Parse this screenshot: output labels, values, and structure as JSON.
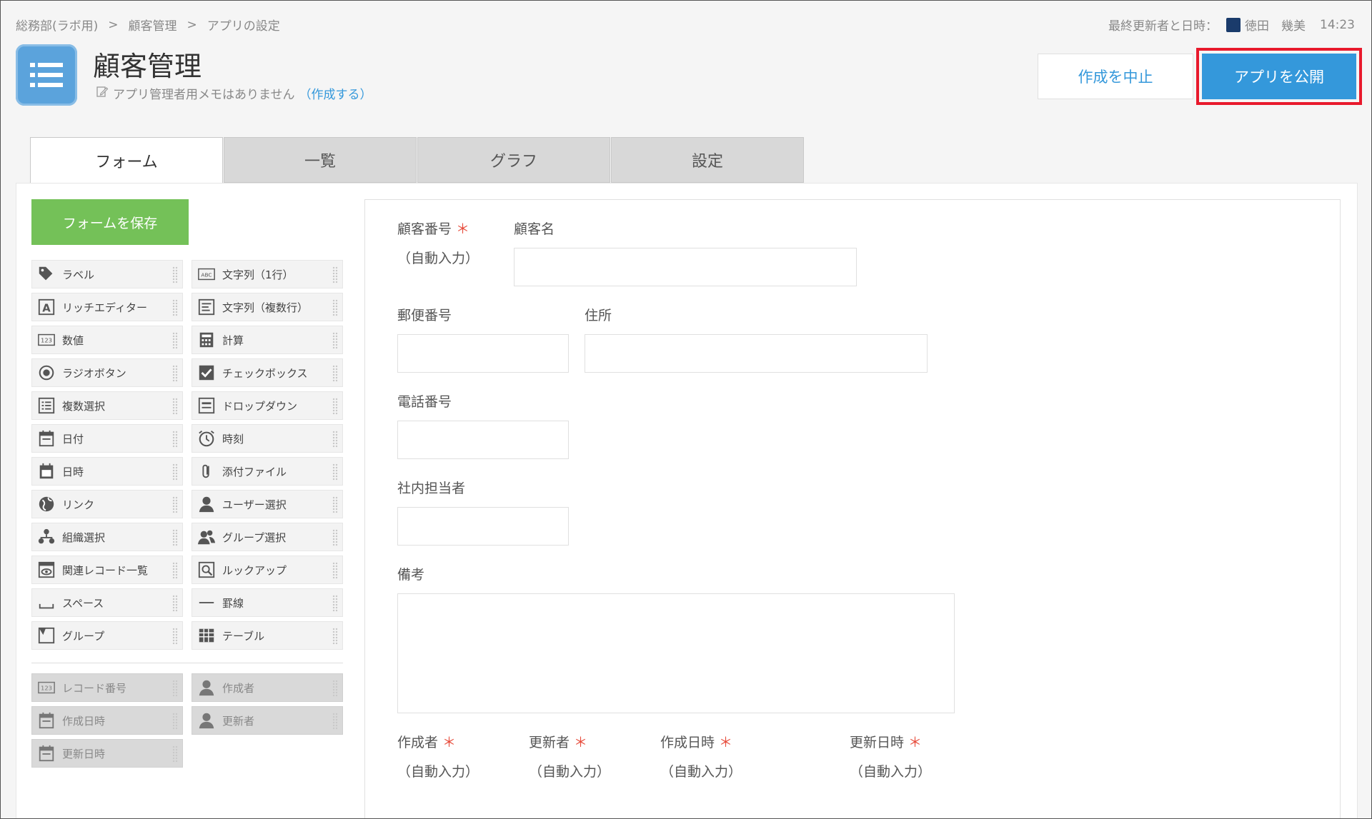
{
  "breadcrumb": [
    "総務部(ラボ用)",
    "顧客管理",
    "アプリの設定"
  ],
  "breadcrumb_sep": ">",
  "meta": {
    "label": "最終更新者と日時：",
    "user": "徳田　幾美",
    "time": "14:23"
  },
  "app": {
    "title": "顧客管理",
    "memo_text": "アプリ管理者用メモはありません",
    "memo_link": "（作成する）"
  },
  "actions": {
    "cancel": "作成を中止",
    "publish": "アプリを公開"
  },
  "tabs": [
    "フォーム",
    "一覧",
    "グラフ",
    "設定"
  ],
  "save_form": "フォームを保存",
  "palette": [
    {
      "label": "ラベル",
      "icon": "tag-icon"
    },
    {
      "label": "文字列（1行）",
      "icon": "abc-icon"
    },
    {
      "label": "リッチエディター",
      "icon": "rich-text-icon"
    },
    {
      "label": "文字列（複数行）",
      "icon": "multiline-icon"
    },
    {
      "label": "数値",
      "icon": "number-icon"
    },
    {
      "label": "計算",
      "icon": "calculator-icon"
    },
    {
      "label": "ラジオボタン",
      "icon": "radio-icon"
    },
    {
      "label": "チェックボックス",
      "icon": "checkbox-icon"
    },
    {
      "label": "複数選択",
      "icon": "multi-select-icon"
    },
    {
      "label": "ドロップダウン",
      "icon": "dropdown-icon"
    },
    {
      "label": "日付",
      "icon": "calendar-icon"
    },
    {
      "label": "時刻",
      "icon": "clock-icon"
    },
    {
      "label": "日時",
      "icon": "datetime-icon"
    },
    {
      "label": "添付ファイル",
      "icon": "paperclip-icon"
    },
    {
      "label": "リンク",
      "icon": "globe-icon"
    },
    {
      "label": "ユーザー選択",
      "icon": "user-icon"
    },
    {
      "label": "組織選択",
      "icon": "org-icon"
    },
    {
      "label": "グループ選択",
      "icon": "group-icon"
    },
    {
      "label": "関連レコード一覧",
      "icon": "related-records-icon"
    },
    {
      "label": "ルックアップ",
      "icon": "lookup-icon"
    },
    {
      "label": "スペース",
      "icon": "space-icon"
    },
    {
      "label": "罫線",
      "icon": "line-icon"
    },
    {
      "label": "グループ",
      "icon": "group-folder-icon"
    },
    {
      "label": "テーブル",
      "icon": "table-icon"
    }
  ],
  "system_fields": [
    {
      "label": "レコード番号",
      "icon": "number-icon"
    },
    {
      "label": "作成者",
      "icon": "user-icon"
    },
    {
      "label": "作成日時",
      "icon": "calendar-icon"
    },
    {
      "label": "更新者",
      "icon": "user-icon"
    },
    {
      "label": "更新日時",
      "icon": "calendar-icon"
    }
  ],
  "form": {
    "customer_number": {
      "label": "顧客番号",
      "auto": "（自動入力）"
    },
    "customer_name": {
      "label": "顧客名"
    },
    "postal_code": {
      "label": "郵便番号"
    },
    "address": {
      "label": "住所"
    },
    "phone": {
      "label": "電話番号"
    },
    "staff": {
      "label": "社内担当者"
    },
    "notes": {
      "label": "備考"
    },
    "created_by": {
      "label": "作成者",
      "auto": "（自動入力）"
    },
    "updated_by": {
      "label": "更新者",
      "auto": "（自動入力）"
    },
    "created_at": {
      "label": "作成日時",
      "auto": "（自動入力）"
    },
    "updated_at": {
      "label": "更新日時",
      "auto": "（自動入力）"
    }
  },
  "required_mark": "＊",
  "colors": {
    "accent": "#3498db",
    "save": "#74c158",
    "highlight": "#e8192c",
    "required": "#e74c3c"
  }
}
